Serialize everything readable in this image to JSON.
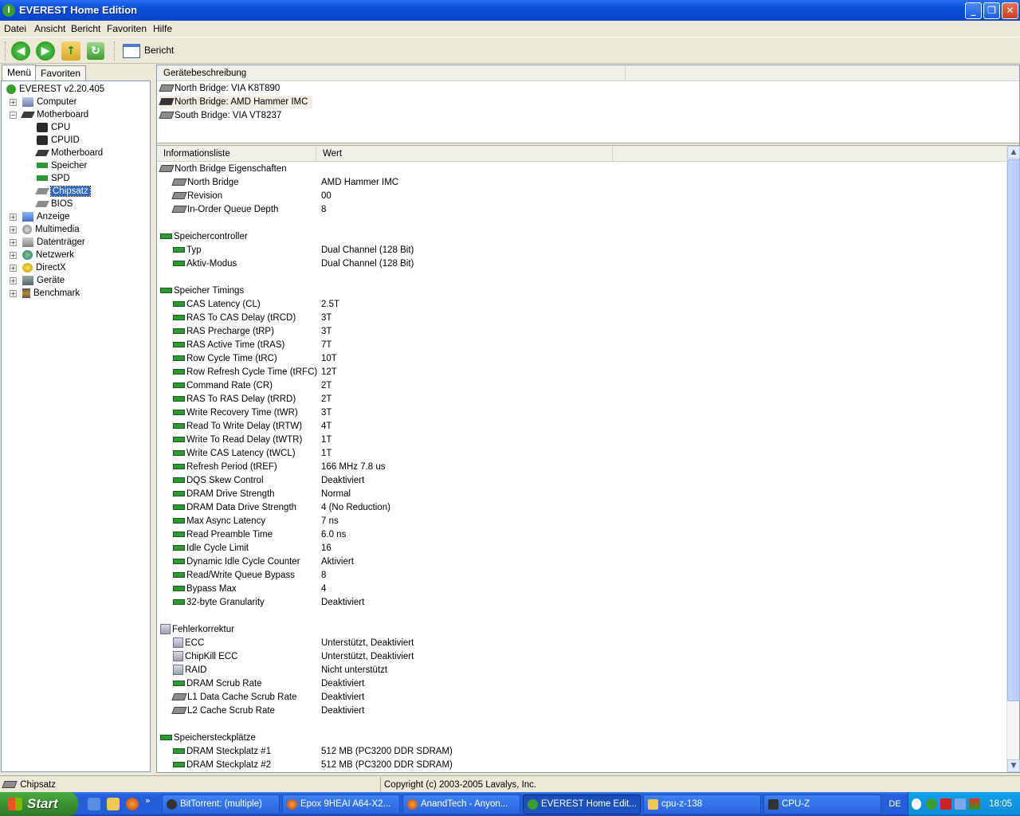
{
  "window": {
    "title": "EVEREST Home Edition"
  },
  "menu": [
    "Datei",
    "Ansicht",
    "Bericht",
    "Favoriten",
    "Hilfe"
  ],
  "toolbar": {
    "report_label": "Bericht"
  },
  "left_tabs": [
    "Menü",
    "Favoriten"
  ],
  "tree": {
    "root": "EVEREST v2.20.405",
    "computer": "Computer",
    "motherboard": "Motherboard",
    "children": [
      "CPU",
      "CPUID",
      "Motherboard",
      "Speicher",
      "SPD",
      "Chipsatz",
      "BIOS"
    ],
    "others": [
      "Anzeige",
      "Multimedia",
      "Datenträger",
      "Netzwerk",
      "DirectX",
      "Geräte",
      "Benchmark"
    ]
  },
  "devices": {
    "header": "Gerätebeschreibung",
    "items": [
      "North Bridge: VIA K8T890",
      "North Bridge: AMD Hammer IMC",
      "South Bridge: VIA VT8237"
    ]
  },
  "info": {
    "col1": "Informationsliste",
    "col2": "Wert",
    "rows": [
      {
        "t": "group",
        "icon": "chip",
        "label": "North Bridge Eigenschaften"
      },
      {
        "t": "item",
        "icon": "chip",
        "label": "North Bridge",
        "value": "AMD Hammer IMC"
      },
      {
        "t": "item",
        "icon": "chip",
        "label": "Revision",
        "value": "00"
      },
      {
        "t": "item",
        "icon": "chip",
        "label": "In-Order Queue Depth",
        "value": "8"
      },
      {
        "t": "blank"
      },
      {
        "t": "group",
        "icon": "ram",
        "label": "Speichercontroller"
      },
      {
        "t": "item",
        "icon": "ram",
        "label": "Typ",
        "value": "Dual Channel  (128 Bit)"
      },
      {
        "t": "item",
        "icon": "ram",
        "label": "Aktiv-Modus",
        "value": "Dual Channel  (128 Bit)"
      },
      {
        "t": "blank"
      },
      {
        "t": "group",
        "icon": "ram",
        "label": "Speicher Timings"
      },
      {
        "t": "item",
        "icon": "ram",
        "label": "CAS Latency (CL)",
        "value": "2.5T"
      },
      {
        "t": "item",
        "icon": "ram",
        "label": "RAS To CAS Delay (tRCD)",
        "value": "3T"
      },
      {
        "t": "item",
        "icon": "ram",
        "label": "RAS Precharge (tRP)",
        "value": "3T"
      },
      {
        "t": "item",
        "icon": "ram",
        "label": "RAS Active Time (tRAS)",
        "value": "7T"
      },
      {
        "t": "item",
        "icon": "ram",
        "label": "Row Cycle Time (tRC)",
        "value": "10T"
      },
      {
        "t": "item",
        "icon": "ram",
        "label": "Row Refresh Cycle Time (tRFC)",
        "value": "12T"
      },
      {
        "t": "item",
        "icon": "ram",
        "label": "Command Rate (CR)",
        "value": "2T"
      },
      {
        "t": "item",
        "icon": "ram",
        "label": "RAS To RAS Delay (tRRD)",
        "value": "2T"
      },
      {
        "t": "item",
        "icon": "ram",
        "label": "Write Recovery Time (tWR)",
        "value": "3T"
      },
      {
        "t": "item",
        "icon": "ram",
        "label": "Read To Write Delay (tRTW)",
        "value": "4T"
      },
      {
        "t": "item",
        "icon": "ram",
        "label": "Write To Read Delay (tWTR)",
        "value": "1T"
      },
      {
        "t": "item",
        "icon": "ram",
        "label": "Write CAS Latency (tWCL)",
        "value": "1T"
      },
      {
        "t": "item",
        "icon": "ram",
        "label": "Refresh Period (tREF)",
        "value": "166 MHz 7.8 us"
      },
      {
        "t": "item",
        "icon": "ram",
        "label": "DQS Skew Control",
        "value": "Deaktiviert"
      },
      {
        "t": "item",
        "icon": "ram",
        "label": "DRAM Drive Strength",
        "value": "Normal"
      },
      {
        "t": "item",
        "icon": "ram",
        "label": "DRAM Data Drive Strength",
        "value": "4  (No Reduction)"
      },
      {
        "t": "item",
        "icon": "ram",
        "label": "Max Async Latency",
        "value": "7 ns"
      },
      {
        "t": "item",
        "icon": "ram",
        "label": "Read Preamble Time",
        "value": "6.0 ns"
      },
      {
        "t": "item",
        "icon": "ram",
        "label": "Idle Cycle Limit",
        "value": "16"
      },
      {
        "t": "item",
        "icon": "ram",
        "label": "Dynamic Idle Cycle Counter",
        "value": "Aktiviert"
      },
      {
        "t": "item",
        "icon": "ram",
        "label": "Read/Write Queue Bypass",
        "value": "8"
      },
      {
        "t": "item",
        "icon": "ram",
        "label": "Bypass Max",
        "value": "4"
      },
      {
        "t": "item",
        "icon": "ram",
        "label": "32-byte Granularity",
        "value": "Deaktiviert"
      },
      {
        "t": "blank"
      },
      {
        "t": "group",
        "icon": "ecc",
        "label": "Fehlerkorrektur"
      },
      {
        "t": "item",
        "icon": "ecc",
        "label": "ECC",
        "value": "Unterstützt, Deaktiviert"
      },
      {
        "t": "item",
        "icon": "ecc",
        "label": "ChipKill ECC",
        "value": "Unterstützt, Deaktiviert"
      },
      {
        "t": "item",
        "icon": "ecc",
        "label": "RAID",
        "value": "Nicht unterstützt"
      },
      {
        "t": "item",
        "icon": "ram",
        "label": "DRAM Scrub Rate",
        "value": "Deaktiviert"
      },
      {
        "t": "item",
        "icon": "chip",
        "label": "L1 Data Cache Scrub Rate",
        "value": "Deaktiviert"
      },
      {
        "t": "item",
        "icon": "chip",
        "label": "L2 Cache Scrub Rate",
        "value": "Deaktiviert"
      },
      {
        "t": "blank"
      },
      {
        "t": "group",
        "icon": "ram",
        "label": "Speichersteckplätze"
      },
      {
        "t": "item",
        "icon": "ram",
        "label": "DRAM Steckplatz #1",
        "value": "512 MB  (PC3200 DDR SDRAM)"
      },
      {
        "t": "item",
        "icon": "ram",
        "label": "DRAM Steckplatz #2",
        "value": "512 MB  (PC3200 DDR SDRAM)"
      }
    ]
  },
  "status": {
    "left": "Chipsatz",
    "right": "Copyright (c) 2003-2005 Lavalys, Inc."
  },
  "taskbar": {
    "start": "Start",
    "tasks": [
      "BitTorrent: (multiple)",
      "Epox 9HEAI A64-X2...",
      "AnandTech - Anyon...",
      "EVEREST Home Edit...",
      "cpu-z-138",
      "CPU-Z"
    ],
    "lang": "DE",
    "clock": "18:05"
  }
}
